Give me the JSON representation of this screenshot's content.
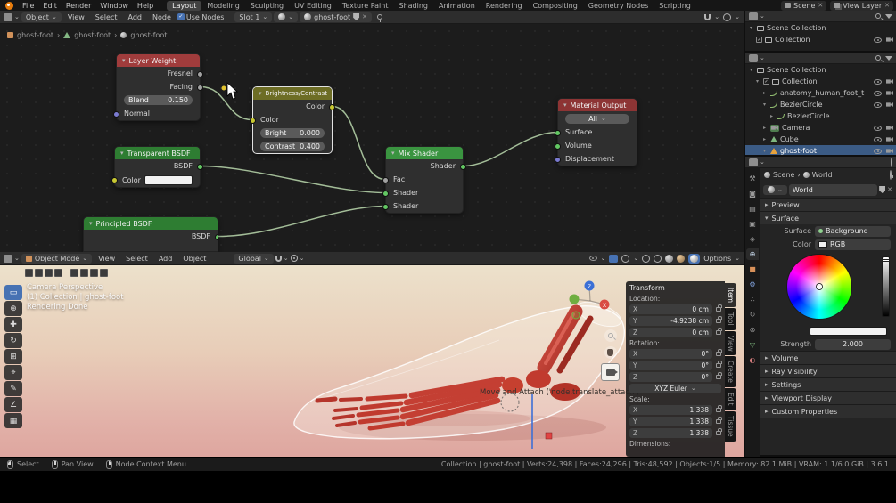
{
  "icons": {
    "chevron_down": "⌄",
    "caret_right": "▸",
    "caret_down": "▾",
    "close": "✕",
    "check": "✓",
    "separator": "›",
    "toolbar_glyphs": [
      "▭",
      "⊕",
      "✚",
      "↻",
      "⊞",
      "⌖",
      "✎",
      "∠",
      "▦"
    ],
    "tab_glyphs": [
      "⚒",
      "◙",
      "▤",
      "▣",
      "◈",
      "⊕",
      "■",
      "⚙",
      "∴",
      "↻",
      "⊗",
      "▽",
      "◐"
    ]
  },
  "colors": {
    "accent_blue": "#4772b3",
    "selected_row_blue": "#3b5b85",
    "node_header_input_red": "#a03c3c",
    "node_header_color_olive": "#6d6d25",
    "node_header_shader_green": "#2e7d32",
    "node_header_mix_green": "#3a9440",
    "node_header_output_red": "#8d3434",
    "viewport_sky_top": "#ece1cb",
    "viewport_sky_bottom": "#dea69f",
    "bone_red": "#c13a2e"
  },
  "topbar": {
    "menus": [
      "File",
      "Edit",
      "Render",
      "Window",
      "Help"
    ],
    "workspaces": [
      "Layout",
      "Modeling",
      "Sculpting",
      "UV Editing",
      "Texture Paint",
      "Shading",
      "Animation",
      "Rendering",
      "Compositing",
      "Geometry Nodes",
      "Scripting"
    ],
    "scene": "Scene",
    "view_layer": "View Layer"
  },
  "shader_editor": {
    "shader_type": "Object",
    "menus": [
      "View",
      "Select",
      "Add",
      "Node"
    ],
    "use_nodes": "Use Nodes",
    "slot": "Slot 1",
    "material": "ghost-foot",
    "breadcrumb": [
      "ghost-foot",
      "ghost-foot",
      "ghost-foot"
    ],
    "nodes": {
      "layer_weight": {
        "title": "Layer Weight",
        "out_fresnel": "Fresnel",
        "out_facing": "Facing",
        "blend_label": "Blend",
        "blend_value": "0.150",
        "in_normal": "Normal"
      },
      "brightness_contrast": {
        "title": "Brightness/Contrast",
        "out_color": "Color",
        "in_color": "Color",
        "bright_label": "Bright",
        "bright_value": "0.000",
        "contrast_label": "Contrast",
        "contrast_value": "0.400"
      },
      "transparent_bsdf": {
        "title": "Transparent BSDF",
        "out_bsdf": "BSDF",
        "in_color": "Color"
      },
      "principled_bsdf": {
        "title": "Principled BSDF",
        "out_bsdf": "BSDF"
      },
      "mix_shader": {
        "title": "Mix Shader",
        "out_shader": "Shader",
        "in_fac": "Fac",
        "in_shader1": "Shader",
        "in_shader2": "Shader"
      },
      "material_output": {
        "title": "Material Output",
        "target": "All",
        "in_surface": "Surface",
        "in_volume": "Volume",
        "in_displacement": "Displacement"
      }
    }
  },
  "viewport": {
    "mode": "Object Mode",
    "menus": [
      "View",
      "Select",
      "Add",
      "Object"
    ],
    "orientation": "Global",
    "options": "Options",
    "info_line1": "Camera Perspective",
    "info_line2": "(1) Collection | ghost-foot",
    "info_line3": "Rendering Done",
    "tooltip": "Move and Attach ('node.translate_attach')",
    "gizmo_x": "X",
    "gizmo_z": "Z",
    "sidebar_tabs": [
      "Item",
      "Tool",
      "View",
      "Create",
      "Edit",
      "Tissue"
    ],
    "transform": {
      "title": "Transform",
      "location_label": "Location:",
      "axis_x": "X",
      "axis_y": "Y",
      "axis_z": "Z",
      "loc_x": "0 cm",
      "loc_y": "-4.9238 cm",
      "loc_z": "0 cm",
      "rotation_label": "Rotation:",
      "rot_x": "0°",
      "rot_y": "0°",
      "rot_z": "0°",
      "rotation_mode": "XYZ Euler",
      "scale_label": "Scale:",
      "scale_x": "1.338",
      "scale_y": "1.338",
      "scale_z": "1.338",
      "dimensions_label": "Dimensions:"
    }
  },
  "outliner_top": {
    "rows": [
      {
        "label": "Scene Collection"
      },
      {
        "label": "Collection"
      }
    ]
  },
  "outliner": {
    "rows": [
      {
        "label": "Scene Collection"
      },
      {
        "label": "Collection"
      },
      {
        "label": "anatomy_human_foot_t"
      },
      {
        "label": "BezierCircle"
      },
      {
        "label": "BezierCircle"
      },
      {
        "label": "Camera"
      },
      {
        "label": "Cube"
      },
      {
        "label": "ghost-foot"
      }
    ]
  },
  "properties": {
    "breadcrumb_scene": "Scene",
    "breadcrumb_world": "World",
    "id_name": "World",
    "panels": {
      "preview": "Preview",
      "surface": "Surface",
      "volume": "Volume",
      "ray_visibility": "Ray Visibility",
      "settings": "Settings",
      "viewport_display": "Viewport Display",
      "custom_properties": "Custom Properties"
    },
    "surface": {
      "surface_label": "Surface",
      "surface_value": "Background",
      "color_label": "Color",
      "color_mode": "RGB",
      "strength_label": "Strength",
      "strength_value": "2.000"
    }
  },
  "statusbar": {
    "select": "Select",
    "pan": "Pan View",
    "context_menu": "Node Context Menu",
    "stats": "Collection | ghost-foot | Verts:24,398 | Faces:24,296 | Tris:48,592 | Objects:1/5 | Memory: 82.1 MiB | VRAM: 1.1/6.0 GiB | 3.6.1"
  }
}
